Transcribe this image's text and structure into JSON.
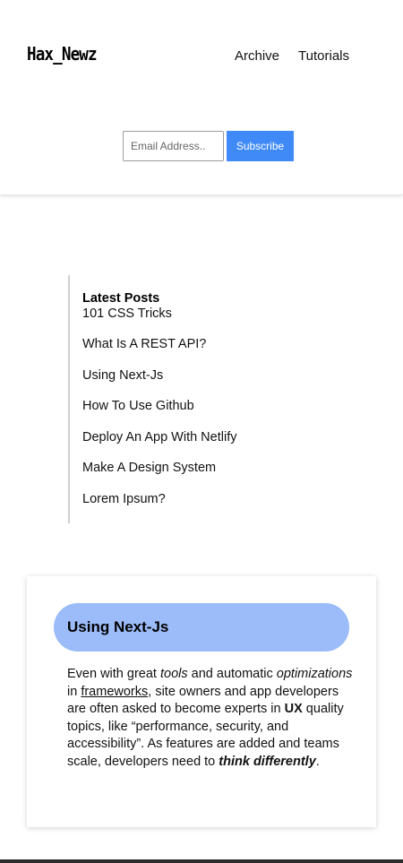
{
  "header": {
    "logo": "Hax_Newz",
    "nav": [
      "Archive",
      "Tutorials"
    ],
    "subscribe": {
      "placeholder": "Email Address..",
      "button_label": "Subscribe"
    }
  },
  "latest_posts": {
    "title": "Latest Posts",
    "items": [
      "101 CSS Tricks",
      "What Is A REST API?",
      "Using Next-Js",
      "How To Use Github",
      "Deploy An App With Netlify",
      "Make A Design System",
      "Lorem Ipsum?"
    ]
  },
  "article": {
    "title": "Using Next-Js",
    "body": {
      "p1": "Even with great ",
      "em1": "tools",
      "p2": " and automatic ",
      "em2": "optimizations",
      "p3": " in ",
      "link": "frameworks",
      "p4": ", site owners and app developers are often asked to become experts in ",
      "strong1": "UX",
      "p5": " quality topics, like “performance, security, and accessibility”. As features are added and teams scale, developers need to ",
      "strong2": "think differently",
      "p6": "."
    }
  },
  "colors": {
    "accent": "#3f8af7",
    "pill": "#9bbcf8"
  }
}
